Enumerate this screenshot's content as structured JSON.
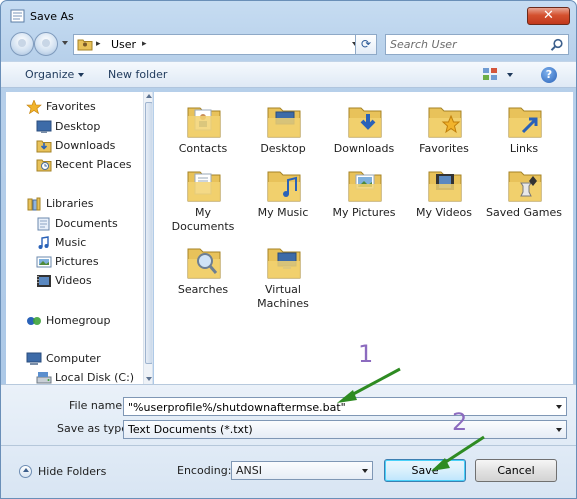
{
  "window": {
    "title": "Save As",
    "close_glyph": "✕"
  },
  "navigation": {
    "address_path": "User",
    "refresh_glyph": "⟳",
    "search_placeholder": "Search User"
  },
  "toolbar": {
    "organize_label": "Organize",
    "new_folder_label": "New folder",
    "help_glyph": "?"
  },
  "sidebar": {
    "items": [
      {
        "label": "Favorites",
        "icon": "star-icon"
      },
      {
        "label": "Desktop",
        "icon": "desktop-icon"
      },
      {
        "label": "Downloads",
        "icon": "downloads-folder-icon"
      },
      {
        "label": "Recent Places",
        "icon": "recent-places-icon"
      },
      {
        "label": "Libraries",
        "icon": "libraries-icon"
      },
      {
        "label": "Documents",
        "icon": "documents-icon"
      },
      {
        "label": "Music",
        "icon": "music-icon"
      },
      {
        "label": "Pictures",
        "icon": "pictures-icon"
      },
      {
        "label": "Videos",
        "icon": "videos-icon"
      },
      {
        "label": "Homegroup",
        "icon": "homegroup-icon"
      },
      {
        "label": "Computer",
        "icon": "computer-icon"
      },
      {
        "label": "Local Disk (C:)",
        "icon": "local-disk-icon"
      }
    ]
  },
  "files": {
    "items": [
      {
        "label": "Contacts",
        "icon": "contacts-folder-icon"
      },
      {
        "label": "Desktop",
        "icon": "desktop-folder-icon"
      },
      {
        "label": "Downloads",
        "icon": "downloads-folder-icon"
      },
      {
        "label": "Favorites",
        "icon": "favorites-folder-icon"
      },
      {
        "label": "Links",
        "icon": "links-folder-icon"
      },
      {
        "label": "My Documents",
        "icon": "my-documents-folder-icon"
      },
      {
        "label": "My Music",
        "icon": "my-music-folder-icon"
      },
      {
        "label": "My Pictures",
        "icon": "my-pictures-folder-icon"
      },
      {
        "label": "My Videos",
        "icon": "my-videos-folder-icon"
      },
      {
        "label": "Saved Games",
        "icon": "saved-games-folder-icon"
      },
      {
        "label": "Searches",
        "icon": "searches-folder-icon"
      },
      {
        "label": "Virtual Machines",
        "icon": "virtual-machines-folder-icon"
      }
    ]
  },
  "form": {
    "file_name_label": "File name:",
    "file_name_value": "\"%userprofile%/shutdownaftermse.bat\"",
    "save_as_type_label": "Save as type:",
    "save_as_type_value": "Text Documents (*.txt)",
    "hide_folders_label": "Hide Folders",
    "encoding_label": "Encoding:",
    "encoding_value": "ANSI",
    "save_label": "Save",
    "cancel_label": "Cancel"
  },
  "annotations": {
    "step1": "1",
    "step2": "2",
    "arrow_color": "#2e8b22"
  },
  "colors": {
    "folder": "#e8c25a",
    "accent": "#3c7fb1"
  }
}
